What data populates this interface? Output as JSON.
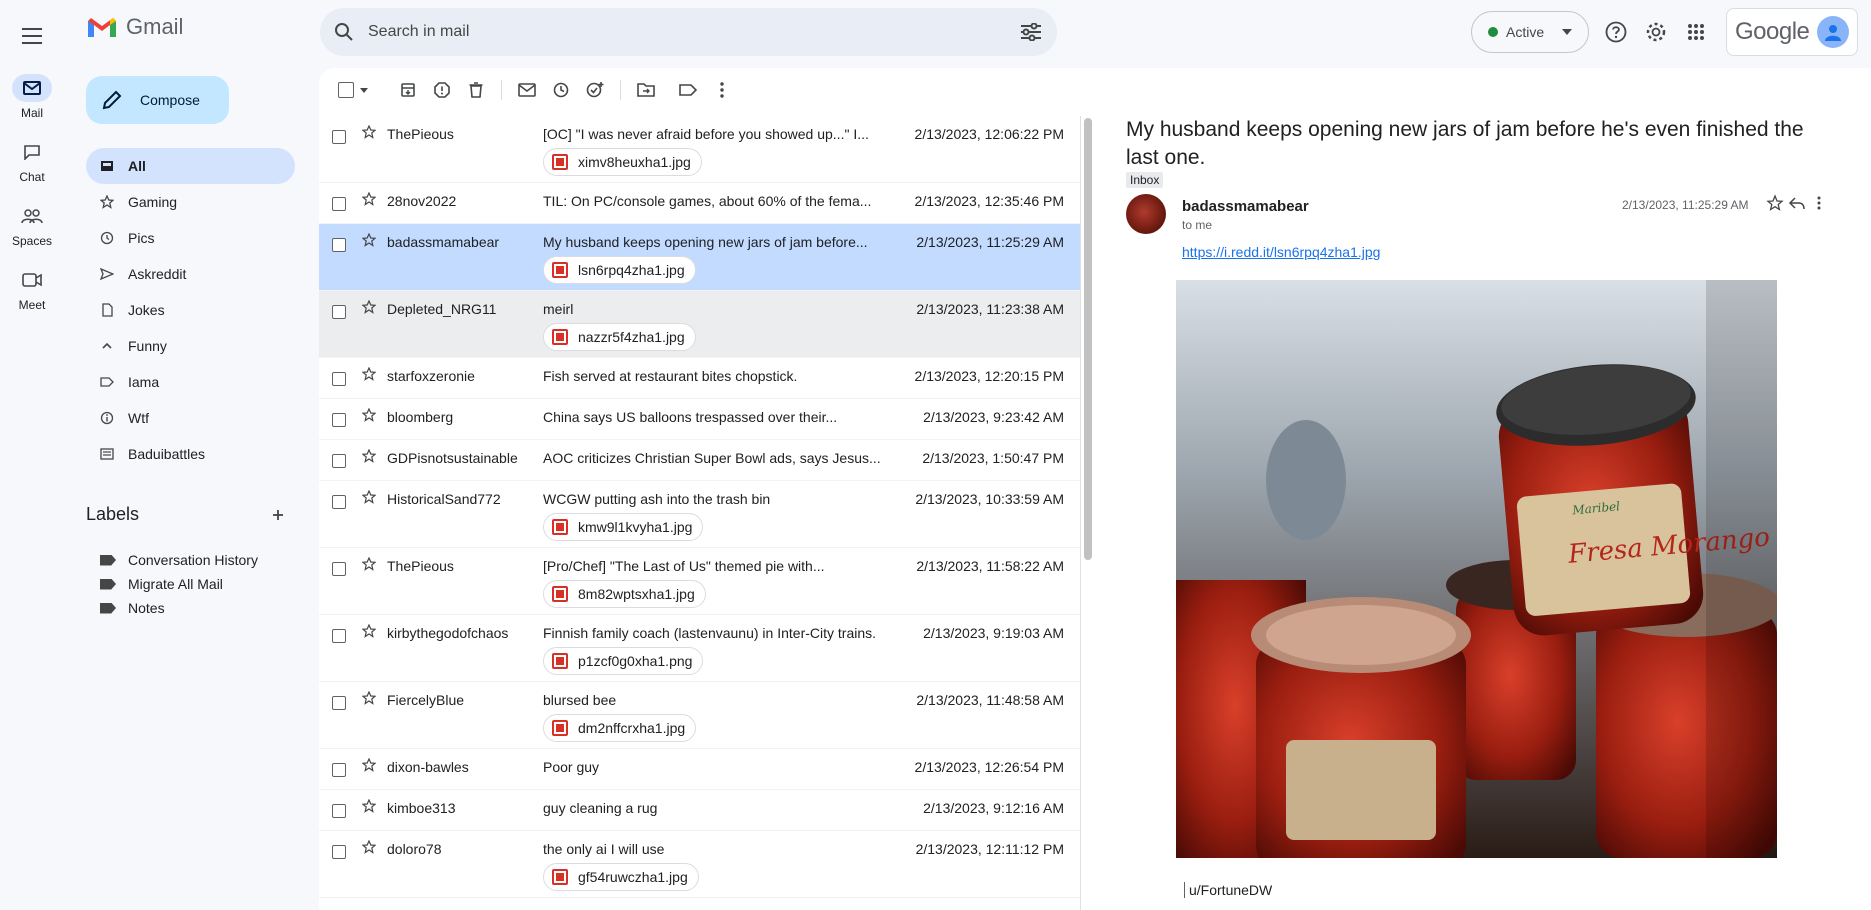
{
  "app": {
    "name": "Gmail"
  },
  "rail": [
    {
      "label": "Mail",
      "icon": "mail-icon",
      "active": true
    },
    {
      "label": "Chat",
      "icon": "chat-icon"
    },
    {
      "label": "Spaces",
      "icon": "spaces-icon"
    },
    {
      "label": "Meet",
      "icon": "meet-icon"
    }
  ],
  "search": {
    "placeholder": "Search in mail"
  },
  "status": {
    "label": "Active",
    "color": "#1e8e3e"
  },
  "account": {
    "brand": "Google"
  },
  "compose": {
    "label": "Compose"
  },
  "nav": [
    {
      "label": "All",
      "icon": "mailbox-icon",
      "active": true
    },
    {
      "label": "Gaming",
      "icon": "star-icon"
    },
    {
      "label": "Pics",
      "icon": "clock-icon"
    },
    {
      "label": "Askreddit",
      "icon": "send-icon"
    },
    {
      "label": "Jokes",
      "icon": "file-icon"
    },
    {
      "label": "Funny",
      "icon": "chevron-up-icon"
    },
    {
      "label": "Iama",
      "icon": "label-icon"
    },
    {
      "label": "Wtf",
      "icon": "info-icon"
    },
    {
      "label": "Baduibattles",
      "icon": "list-icon"
    }
  ],
  "labels": {
    "title": "Labels",
    "items": [
      "Conversation History",
      "Migrate All Mail",
      "Notes"
    ]
  },
  "emails": [
    {
      "sender": "ThePieous",
      "subject": "[OC] \"I was never afraid before you showed up...\" I...",
      "attachment": "ximv8heuxha1.jpg",
      "date": "2/13/2023, 12:06:22 PM"
    },
    {
      "sender": "28nov2022",
      "subject": "TIL: On PC/console games, about 60% of the fema...",
      "attachment": "",
      "date": "2/13/2023, 12:35:46 PM"
    },
    {
      "sender": "badassmamabear",
      "subject": "My husband keeps opening new jars of jam before...",
      "attachment": "lsn6rpq4zha1.jpg",
      "date": "2/13/2023, 11:25:29 AM",
      "state": "selected"
    },
    {
      "sender": "Depleted_NRG11",
      "subject": "meirl",
      "attachment": "nazzr5f4zha1.jpg",
      "date": "2/13/2023, 11:23:38 AM",
      "state": "hover"
    },
    {
      "sender": "starfoxzeronie",
      "subject": "Fish served at restaurant bites chopstick.",
      "attachment": "",
      "date": "2/13/2023, 12:20:15 PM"
    },
    {
      "sender": "bloomberg",
      "subject": "China says US balloons trespassed over their...",
      "attachment": "",
      "date": "2/13/2023, 9:23:42 AM"
    },
    {
      "sender": "GDPisnotsustainable",
      "subject": "AOC criticizes Christian Super Bowl ads, says Jesus...",
      "attachment": "",
      "date": "2/13/2023, 1:50:47 PM"
    },
    {
      "sender": "HistoricalSand772",
      "subject": "WCGW putting ash into the trash bin",
      "attachment": "kmw9l1kvyha1.jpg",
      "date": "2/13/2023, 10:33:59 AM"
    },
    {
      "sender": "ThePieous",
      "subject": "[Pro/Chef] \"The Last of Us\" themed pie with...",
      "attachment": "8m82wptsxha1.jpg",
      "date": "2/13/2023, 11:58:22 AM"
    },
    {
      "sender": "kirbythegodofchaos",
      "subject": "Finnish family coach (lastenvaunu) in Inter-City trains.",
      "attachment": "p1zcf0g0xha1.png",
      "date": "2/13/2023, 9:19:03 AM"
    },
    {
      "sender": "FiercelyBlue",
      "subject": "blursed bee",
      "attachment": "dm2nffcrxha1.jpg",
      "date": "2/13/2023, 11:48:58 AM"
    },
    {
      "sender": "dixon-bawles",
      "subject": "Poor guy",
      "attachment": "",
      "date": "2/13/2023, 12:26:54 PM"
    },
    {
      "sender": "kimboe313",
      "subject": "guy cleaning a rug",
      "attachment": "",
      "date": "2/13/2023, 9:12:16 AM"
    },
    {
      "sender": "doloro78",
      "subject": "the only ai I will use",
      "attachment": "gf54ruwczha1.jpg",
      "date": "2/13/2023, 12:11:12 PM"
    }
  ],
  "reader": {
    "subject": "My husband keeps opening new jars of jam before he's even finished the last one.",
    "badge": "Inbox",
    "sender": "badassmamabear",
    "to": "to me",
    "date": "2/13/2023, 11:25:29 AM",
    "link": "https://i.redd.it/lsn6rpq4zha1.jpg",
    "quote_author": "u/FortuneDW",
    "jar_label_brand": "Maribel",
    "jar_label_flavor": "Fresa Morango"
  }
}
